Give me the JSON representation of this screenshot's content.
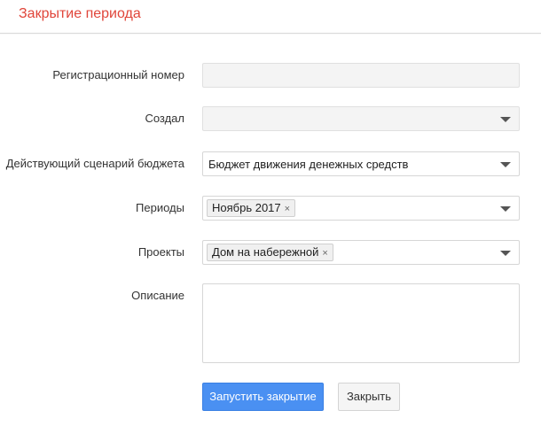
{
  "header": {
    "title": "Закрытие периода"
  },
  "form": {
    "registration_number": {
      "label": "Регистрационный номер",
      "value": ""
    },
    "created_by": {
      "label": "Создал",
      "value": ""
    },
    "budget_scenario": {
      "label": "Действующий сценарий бюджета",
      "value": "Бюджет движения денежных средств"
    },
    "periods": {
      "label": "Периоды",
      "tags": [
        "Ноябрь 2017"
      ],
      "tag_remove": "×"
    },
    "projects": {
      "label": "Проекты",
      "tags": [
        "Дом на набережной"
      ],
      "tag_remove": "×"
    },
    "description": {
      "label": "Описание",
      "value": ""
    }
  },
  "buttons": {
    "start_close": "Запустить закрытие",
    "close": "Закрыть"
  },
  "colors": {
    "title": "#e0453a",
    "primary_button": "#4a90f2",
    "disabled_field": "#f4f4f4"
  }
}
